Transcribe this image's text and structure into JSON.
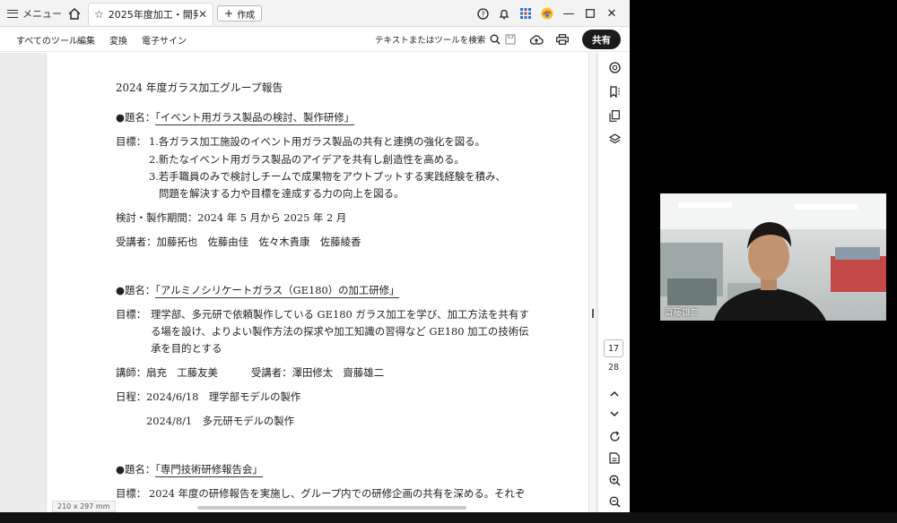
{
  "tabbar": {
    "menu_label": "メニュー",
    "tab_title": "2025年度加工・開発...",
    "create_label": "作成"
  },
  "toolbar": {
    "all_tools": "すべてのツール",
    "edit": "編集",
    "convert": "変換",
    "e_sign": "電子サイン",
    "search_placeholder": "テキストまたはツールを検索",
    "share": "共有"
  },
  "document": {
    "title": "2024 年度ガラス加工グループ報告",
    "sections": [
      {
        "theme_prefix": "●題名：",
        "theme": "「イベント用ガラス製品の検討、製作研修」",
        "goal_label": "目標：",
        "goals": [
          "1.各ガラス加工施設のイベント用ガラス製品の共有と連携の強化を図る。",
          "2.新たなイベント用ガラス製品のアイデアを共有し創造性を高める。",
          "3.若手職員のみで検討しチームで成果物をアウトプットする実践経験を積み、",
          "問題を解決する力や目標を達成する力の向上を図る。"
        ],
        "period": "検討・製作期間：2024 年 5 月から 2025 年 2 月",
        "attendees": "受講者：加藤拓也　佐藤由佳　佐々木貴康　佐藤綾香"
      },
      {
        "theme_prefix": "●題名：",
        "theme": "「アルミノシリケートガラス（GE180）の加工研修」",
        "goal_label": "目標：",
        "goals": [
          "理学部、多元研で依頼製作している GE180 ガラス加工を学び、加工方法を共有す",
          "る場を設け、よりよい製作方法の探求や加工知識の習得など GE180 加工の技術伝",
          "承を目的とする"
        ],
        "instructors": "講師：扇充　工藤友美",
        "attendees": "受講者：澤田修太　齋藤雄二",
        "schedule_label": "日程：",
        "schedule": [
          "2024/6/18　理学部モデルの製作",
          "2024/8/1　多元研モデルの製作"
        ]
      },
      {
        "theme_prefix": "●題名：",
        "theme": "「専門技術研修報告会」",
        "goal_label": "目標：",
        "goals": [
          "2024 年度の研修報告を実施し、グループ内での研修企画の共有を深める。それぞ"
        ]
      }
    ]
  },
  "status": {
    "page_size": "210 x 297 mm"
  },
  "pagination": {
    "current": "17",
    "total": "28"
  },
  "video": {
    "participant_name": "齋藤雄二"
  }
}
